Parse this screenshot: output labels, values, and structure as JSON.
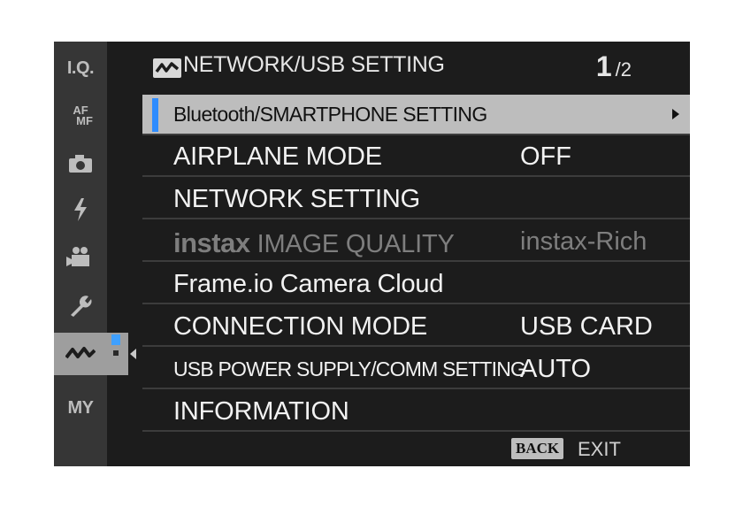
{
  "sidebar": {
    "tabs": [
      {
        "name": "image-quality",
        "label": "I.Q."
      },
      {
        "name": "af-mf",
        "label_top": "AF",
        "label_bottom": "MF"
      },
      {
        "name": "shooting",
        "icon": "camera-icon"
      },
      {
        "name": "flash",
        "icon": "flash-icon"
      },
      {
        "name": "movie",
        "icon": "movie-camera-icon"
      },
      {
        "name": "setup",
        "icon": "wrench-icon"
      },
      {
        "name": "network",
        "icon": "network-icon",
        "active": true
      },
      {
        "name": "my-menu",
        "label": "MY"
      }
    ]
  },
  "header": {
    "icon": "network-icon",
    "title": "NETWORK/USB SETTING",
    "page_current": "1",
    "page_total": "/2"
  },
  "menu": {
    "items": [
      {
        "label": "Bluetooth/SMARTPHONE SETTING",
        "value": "",
        "selected": true,
        "has_submenu": true
      },
      {
        "label": "AIRPLANE MODE",
        "value": "OFF"
      },
      {
        "label": "NETWORK SETTING",
        "value": ""
      },
      {
        "label_brand": "instax",
        "label": "IMAGE QUALITY",
        "value": "instax-Rich",
        "disabled": true
      },
      {
        "label": "Frame.io Camera Cloud",
        "value": ""
      },
      {
        "label": "CONNECTION MODE",
        "value": "USB CARD"
      },
      {
        "label": "USB POWER SUPPLY/COMM SETTING",
        "value": "AUTO"
      },
      {
        "label": "INFORMATION",
        "value": ""
      }
    ]
  },
  "footer": {
    "back_key": "BACK",
    "exit_label": "EXIT"
  },
  "colors": {
    "accent": "#2e8cff",
    "selected_row": "#bdbdbd",
    "background": "#1c1c1c"
  }
}
